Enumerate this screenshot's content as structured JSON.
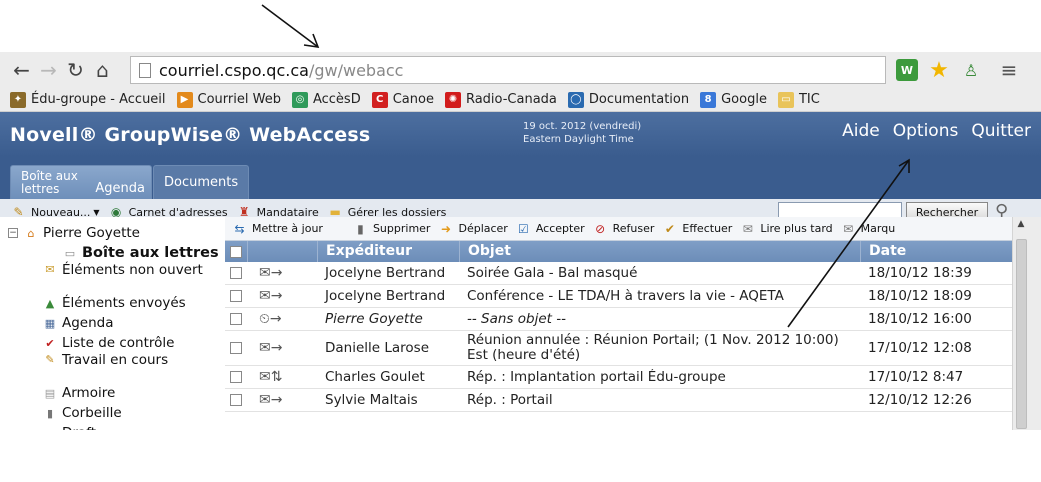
{
  "browser": {
    "url_host": "courriel.cspo.qc.ca",
    "url_path": "/gw/webacc",
    "bookmarks": [
      {
        "label": "Édu-groupe - Accueil",
        "icon": "edugroupe-icon",
        "color": "#8a6a2a"
      },
      {
        "label": "Courriel Web",
        "icon": "courriel-icon",
        "color": "#e38a1c"
      },
      {
        "label": "AccèsD",
        "icon": "accesd-icon",
        "color": "#2f9a5a"
      },
      {
        "label": "Canoe",
        "icon": "canoe-icon",
        "color": "#d22020"
      },
      {
        "label": "Radio-Canada",
        "icon": "radio-canada-icon",
        "color": "#d21c1c"
      },
      {
        "label": "Documentation",
        "icon": "dell-icon",
        "color": "#2a6ab0"
      },
      {
        "label": "Google",
        "icon": "google-icon",
        "color": "#3a78d8"
      },
      {
        "label": "TIC",
        "icon": "folder-icon",
        "color": "#e9c45a"
      }
    ]
  },
  "header": {
    "title": "Novell® GroupWise® WebAccess",
    "date_line1": "19 oct. 2012 (vendredi)",
    "date_line2": "Eastern Daylight Time",
    "links": [
      "Aide",
      "Options",
      "Quitter"
    ]
  },
  "tabs": {
    "mailbox_line1": "Boîte aux",
    "mailbox_line2": "lettres",
    "agenda": "Agenda",
    "documents": "Documents"
  },
  "actions": {
    "new": "Nouveau...",
    "address_book": "Carnet d'adresses",
    "proxy": "Mandataire",
    "manage_folders": "Gérer les dossiers",
    "search_button": "Rechercher"
  },
  "folders": {
    "root": "Pierre Goyette",
    "items": [
      {
        "label": "Boîte aux lettres",
        "icon": "mailbox-icon"
      },
      {
        "label": "Éléments non ouvert",
        "icon": "unopened-icon"
      },
      {
        "label": "Éléments envoyés",
        "icon": "sent-icon"
      },
      {
        "label": "Agenda",
        "icon": "calendar-icon"
      },
      {
        "label": "Liste de contrôle",
        "icon": "checklist-icon"
      },
      {
        "label": "Travail en cours",
        "icon": "work-icon"
      },
      {
        "label": "Armoire",
        "icon": "cabinet-icon"
      },
      {
        "label": "Corbeille",
        "icon": "trash-icon"
      },
      {
        "label": "Draft",
        "icon": "folder-icon"
      }
    ]
  },
  "list_toolbar": {
    "refresh": "Mettre à jour",
    "delete": "Supprimer",
    "move": "Déplacer",
    "accept": "Accepter",
    "decline": "Refuser",
    "complete": "Effectuer",
    "read_later": "Lire plus tard",
    "mark": "Marqu"
  },
  "table": {
    "headers": {
      "from": "Expéditeur",
      "subject": "Objet",
      "date": "Date"
    },
    "rows": [
      {
        "from": "Jocelyne Bertrand",
        "subject": "Soirée Gala - Bal masqué",
        "date": "18/10/12 18:39"
      },
      {
        "from": "Jocelyne Bertrand",
        "subject": "Conférence - LE TDA/H à travers la vie - AQETA",
        "date": "18/10/12 18:09"
      },
      {
        "from": "Pierre Goyette",
        "subject": "-- Sans objet --",
        "date": "18/10/12 16:00"
      },
      {
        "from": "Danielle Larose",
        "subject": "Réunion annulée : Réunion Portail; (1 Nov. 2012 10:00) Est (heure d'été)",
        "date": "17/10/12 12:08"
      },
      {
        "from": "Charles Goulet",
        "subject": "Rép. : Implantation portail Édu-groupe",
        "date": "17/10/12 8:47"
      },
      {
        "from": "Sylvie Maltais",
        "subject": "Rép. : Portail",
        "date": "12/10/12 12:26"
      }
    ]
  }
}
